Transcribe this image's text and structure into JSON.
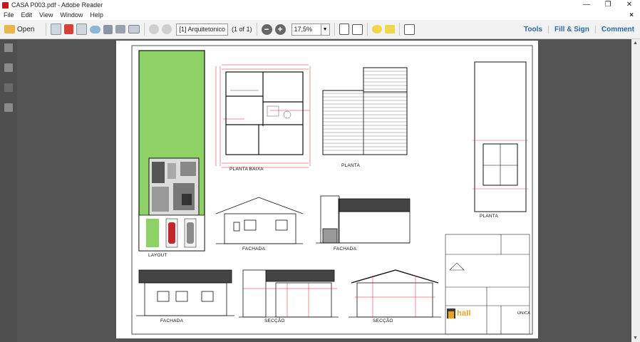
{
  "window": {
    "title": "CASA P003.pdf - Adobe Reader",
    "controls": {
      "minimize": "—",
      "restore": "❐",
      "close": "✕"
    }
  },
  "menu": {
    "items": [
      "File",
      "Edit",
      "View",
      "Window",
      "Help"
    ],
    "close_doc": "×"
  },
  "toolbar": {
    "open_label": "Open",
    "page_field": "[1] Arquitetonico",
    "page_count": "(1 of 1)",
    "zoom_value": "17,5%",
    "zoom_out": "−",
    "zoom_in": "+",
    "right_links": [
      "Tools",
      "Fill & Sign",
      "Comment"
    ]
  },
  "drawing": {
    "labels": {
      "layout": "LAYOUT",
      "planta_baixa": "PLANTA BAIXA",
      "planta_cobertura": "PLANTA",
      "planta_situacao": "PLANTA",
      "fachada_frontal": "FACHADA",
      "fachada_lateral": "FACHADA",
      "fachada_posterior": "FACHADA",
      "seccao_longitudinal": "SECÇÃO",
      "seccao_transversal": "SECÇÃO",
      "logo_text": "hall",
      "stamp_label": "ÚNICA"
    }
  },
  "colors": {
    "accent": "#2b6aa6",
    "lawn": "#8ed164",
    "workspace": "#545454",
    "dimension_red": "#d9232d"
  }
}
